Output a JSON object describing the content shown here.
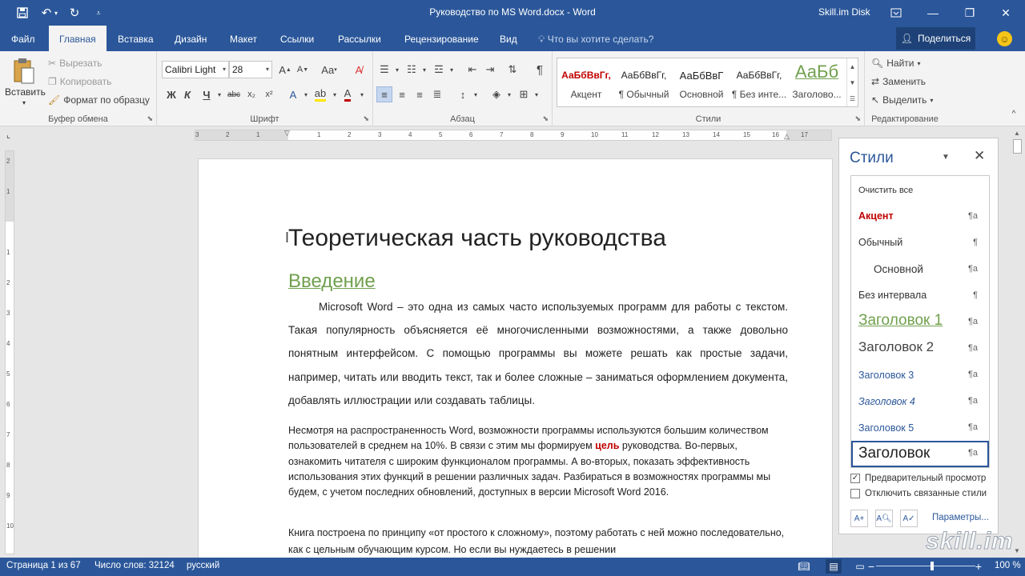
{
  "titlebar": {
    "doc_title": "Руководство по MS Word.docx  -  Word",
    "account": "Skill.im Disk"
  },
  "tabs": [
    {
      "label": "Файл"
    },
    {
      "label": "Главная"
    },
    {
      "label": "Вставка"
    },
    {
      "label": "Дизайн"
    },
    {
      "label": "Макет"
    },
    {
      "label": "Ссылки"
    },
    {
      "label": "Рассылки"
    },
    {
      "label": "Рецензирование"
    },
    {
      "label": "Вид"
    }
  ],
  "tellme": "Что вы хотите сделать?",
  "share": "Поделиться",
  "ribbon": {
    "clipboard": {
      "paste": "Вставить",
      "cut": "Вырезать",
      "copy": "Копировать",
      "format_painter": "Формат по образцу",
      "label": "Буфер обмена"
    },
    "font": {
      "name": "Calibri Light",
      "size": "28",
      "label": "Шрифт",
      "bold": "Ж",
      "italic": "К",
      "underline": "Ч",
      "strike": "abc",
      "grow": "A",
      "shrink": "A",
      "case": "Aa"
    },
    "paragraph": {
      "label": "Абзац"
    },
    "styles": {
      "label": "Стили",
      "items": [
        {
          "sample": "АаБбВвГг,",
          "name": "Акцент"
        },
        {
          "sample": "АаБбВвГг,",
          "name": "¶ Обычный"
        },
        {
          "sample": "АаБбВвГ",
          "name": "Основной"
        },
        {
          "sample": "АаБбВвГг,",
          "name": "¶ Без инте..."
        },
        {
          "sample": "АаБб",
          "name": "Заголово..."
        }
      ]
    },
    "editing": {
      "find": "Найти",
      "replace": "Заменить",
      "select": "Выделить",
      "label": "Редактирование"
    }
  },
  "ruler_numbers": [
    "3",
    "2",
    "1",
    "1",
    "2",
    "3",
    "4",
    "5",
    "6",
    "7",
    "8",
    "9",
    "10",
    "11",
    "12",
    "13",
    "14",
    "15",
    "16",
    "17"
  ],
  "vruler_numbers": [
    "2",
    "1",
    "1",
    "2",
    "3",
    "4",
    "5",
    "6",
    "7",
    "8",
    "9",
    "10"
  ],
  "document": {
    "title": "Теоретическая часть руководства",
    "heading": "Введение",
    "para1": "Microsoft Word – это одна из самых часто используемых программ для работы с текстом. Такая популярность объясняется её многочисленными возможностями, а также довольно понятным интерфейсом. С помощью программы вы можете решать как простые задачи, например, читать или вводить текст, так и более сложные – заниматься оформлением документа, добавлять иллюстрации или создавать таблицы.",
    "para2_before": "Несмотря на распространенность Word, возможности программы используются большим количеством пользователей в среднем на 10%. В связи с этим мы формируем ",
    "para2_red": "цель",
    "para2_after": " руководства. Во-первых, ознакомить читателя с широким функционалом программы. А во-вторых, показать эффективность использования этих функций в решении различных задач. Разбираться в возможностях программы мы будем, с учетом последних обновлений, доступных в версии Microsoft Word 2016.",
    "para3": "Книга построена по принципу «от простого к сложному», поэтому работать с ней можно последовательно, как с цельным обучающим курсом. Но если вы нуждаетесь в решении"
  },
  "styles_pane": {
    "title": "Стили",
    "items": [
      {
        "label": "Очистить все",
        "mark": ""
      },
      {
        "label": "Акцент",
        "mark": "¶a"
      },
      {
        "label": "Обычный",
        "mark": "¶"
      },
      {
        "label": "Основной",
        "mark": "¶a"
      },
      {
        "label": "Без интервала",
        "mark": "¶"
      },
      {
        "label": "Заголовок 1",
        "mark": "¶a"
      },
      {
        "label": "Заголовок 2",
        "mark": "¶a"
      },
      {
        "label": "Заголовок 3",
        "mark": "¶a"
      },
      {
        "label": "Заголовок 4",
        "mark": "¶a"
      },
      {
        "label": "Заголовок 5",
        "mark": "¶a"
      },
      {
        "label": "Заголовок",
        "mark": "¶a"
      }
    ],
    "preview": "Предварительный просмотр",
    "disable_linked": "Отключить связанные стили",
    "params": "Параметры..."
  },
  "statusbar": {
    "page": "Страница 1 из 67",
    "words": "Число слов: 32124",
    "lang": "русский",
    "zoom": "100 %"
  },
  "watermark": "skill.im",
  "colors": {
    "brand": "#2b579a",
    "accent_red": "#c00000",
    "heading_green": "#70a04d"
  }
}
